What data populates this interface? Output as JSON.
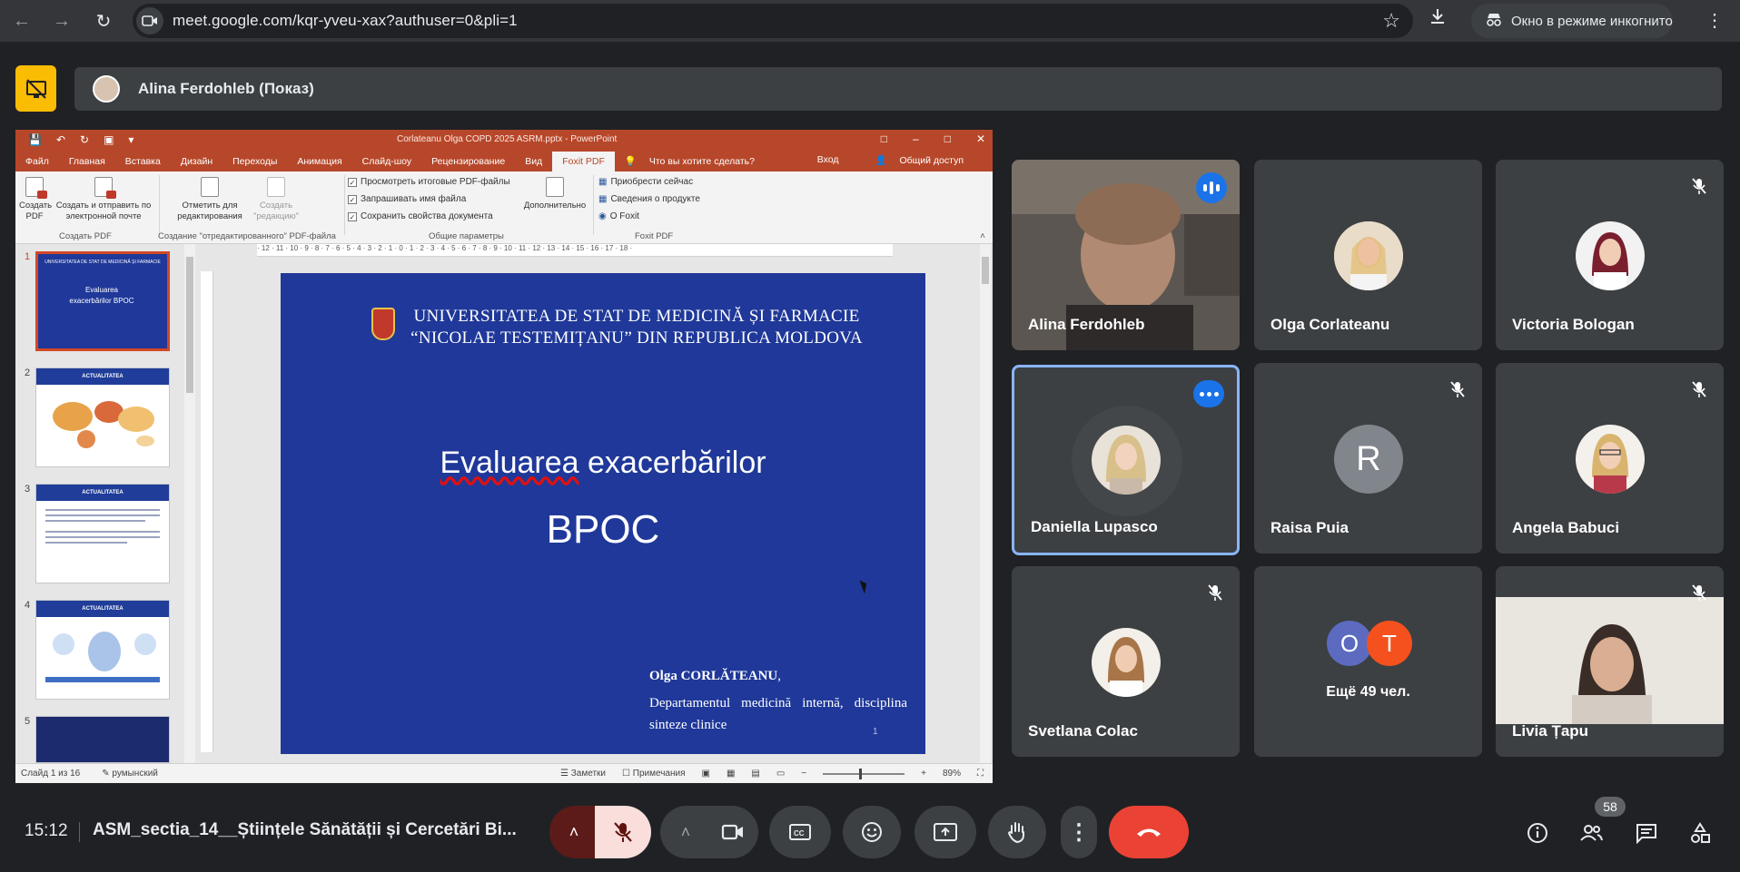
{
  "browser": {
    "url": "meet.google.com/kqr-yveu-xax?authuser=0&pli=1",
    "incognito_label": "Окно в режиме инкогнито"
  },
  "presenter": {
    "label": "Alina Ferdohleb (Показ)"
  },
  "ppt": {
    "doc_title": "Corlateanu Olga COPD 2025 ASRM.pptx - PowerPoint",
    "menu": [
      "Файл",
      "Главная",
      "Вставка",
      "Дизайн",
      "Переходы",
      "Анимация",
      "Слайд-шоу",
      "Рецензирование",
      "Вид"
    ],
    "active_tab": "Foxit PDF",
    "tell_me": "Что вы хотите сделать?",
    "signin": "Вход",
    "share": "Общий доступ",
    "ribbon": {
      "create_pdf": "Создать PDF",
      "create_send": "Создать и отправить по электронной почте",
      "group_create": "Создать PDF",
      "mark_edit": "Отметить для редактирования",
      "create_edit": "Создать \"редакцию\"",
      "group_edit": "Создание \"отредактированного\" PDF-файла",
      "opt1": "Просмотреть итоговые PDF-файлы",
      "opt2": "Запрашивать имя файла",
      "opt3": "Сохранить свойства документа",
      "advanced": "Дополнительно",
      "group_general": "Общие параметры",
      "buy": "Приобрести сейчас",
      "product_info": "Сведения о продукте",
      "about": "О Foxit",
      "group_foxit": "Foxit PDF"
    },
    "thumbs": [
      {
        "num": "1",
        "header": "UNIVERSITATEA DE STAT DE MEDICINĂ ȘI FARMACIE",
        "title": "Evaluarea exacerbărilor BPOC"
      },
      {
        "num": "2",
        "header": "ACTUALITATEA"
      },
      {
        "num": "3",
        "header": "ACTUALITATEA"
      },
      {
        "num": "4",
        "header": "ACTUALITATEA"
      },
      {
        "num": "5"
      }
    ],
    "slide": {
      "university_line1": "UNIVERSITATEA DE STAT DE MEDICINĂ ȘI FARMACIE",
      "university_line2": "“NICOLAE TESTEMIȚANU” DIN REPUBLICA MOLDOVA",
      "title_word1": "Evaluarea",
      "title_word2": "exacerbărilor",
      "subtitle": "BPOC",
      "author": "Olga CORLĂTEANU",
      "author_comma": ",",
      "department": "Departamentul medicină internă, disciplina sinteze clinice",
      "number": "1"
    },
    "status": {
      "slide_of": "Слайд 1 из 16",
      "language": "румынский",
      "notes": "Заметки",
      "comments": "Примечания",
      "zoom": "89%"
    }
  },
  "participants": [
    {
      "name": "Alina Ferdohleb",
      "state": "speaking"
    },
    {
      "name": "Olga Corlateanu",
      "state": "unmuted"
    },
    {
      "name": "Victoria Bologan",
      "state": "muted"
    },
    {
      "name": "Daniella Lupasco",
      "state": "active-more"
    },
    {
      "name": "Raisa Puia",
      "state": "muted",
      "initial": "R"
    },
    {
      "name": "Angela Babuci",
      "state": "muted"
    },
    {
      "name": "Svetlana Colac",
      "state": "muted"
    },
    {
      "name": "",
      "more_initials": [
        "O",
        "T"
      ],
      "more_label": "Ещё 49 чел."
    },
    {
      "name": "Livia Țapu",
      "state": "muted"
    }
  ],
  "bottom": {
    "time": "15:12",
    "meeting_name": "ASM_sectia_14__Științele Sănătății și Cercetări Bi...",
    "participant_count": "58"
  },
  "colors": {
    "meet_bg": "#202124",
    "tile_bg": "#3c4043",
    "end_call": "#ea4335",
    "accent_blue": "#1a73e8",
    "ppt_red": "#b7472a",
    "slide_blue": "#1f3899",
    "present_yellow": "#fbbc04"
  }
}
